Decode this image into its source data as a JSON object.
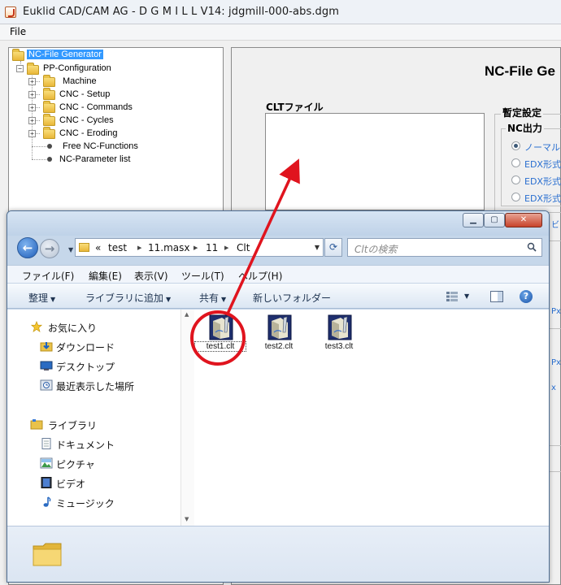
{
  "app": {
    "title": "Euklid CAD/CAM AG  -  D G M I L L  V14:  jdgmill-000-abs.dgm",
    "menu": [
      "File"
    ]
  },
  "tree": {
    "root": "NC-File Generator",
    "pp_config": "PP-Configuration",
    "folders": [
      "Machine",
      "CNC - Setup",
      "CNC - Commands",
      "CNC - Cycles",
      "CNC - Eroding"
    ],
    "leaves": [
      "Free NC-Functions",
      "NC-Parameter list"
    ]
  },
  "content": {
    "title_fragment": "NC-File Ge",
    "clt_label": "CLTファイル",
    "group1_title": "暫定設定",
    "group2_title": "NC出力",
    "radio_options": [
      "ノーマル",
      "EDX形式",
      "EDX形式",
      "EDX形式"
    ],
    "radio_selected_index": 0,
    "edge_fragments": [
      "ビ",
      "Px",
      "Px",
      "x"
    ]
  },
  "explorer": {
    "breadcrumb_prefix": "«",
    "path": [
      "test",
      "11.masx",
      "11",
      "Clt"
    ],
    "search_placeholder": "Cltの検索",
    "menu": [
      "ファイル(F)",
      "編集(E)",
      "表示(V)",
      "ツール(T)",
      "ヘルプ(H)"
    ],
    "toolbar": {
      "organize": "整理",
      "add_to_library": "ライブラリに追加",
      "share": "共有",
      "new_folder": "新しいフォルダー"
    },
    "nav": {
      "favorites_header": "お気に入り",
      "favorites": [
        "ダウンロード",
        "デスクトップ",
        "最近表示した場所"
      ],
      "libraries_header": "ライブラリ",
      "libraries": [
        "ドキュメント",
        "ピクチャ",
        "ビデオ",
        "ミュージック"
      ]
    },
    "files": [
      "test1.clt",
      "test2.clt",
      "test3.clt"
    ],
    "focused_file_index": 0
  },
  "colors": {
    "selection": "#3399ff",
    "annotation_red": "#e0141e",
    "link_blue": "#2a6fd0",
    "explorer_frame": "#c6d7ea"
  }
}
